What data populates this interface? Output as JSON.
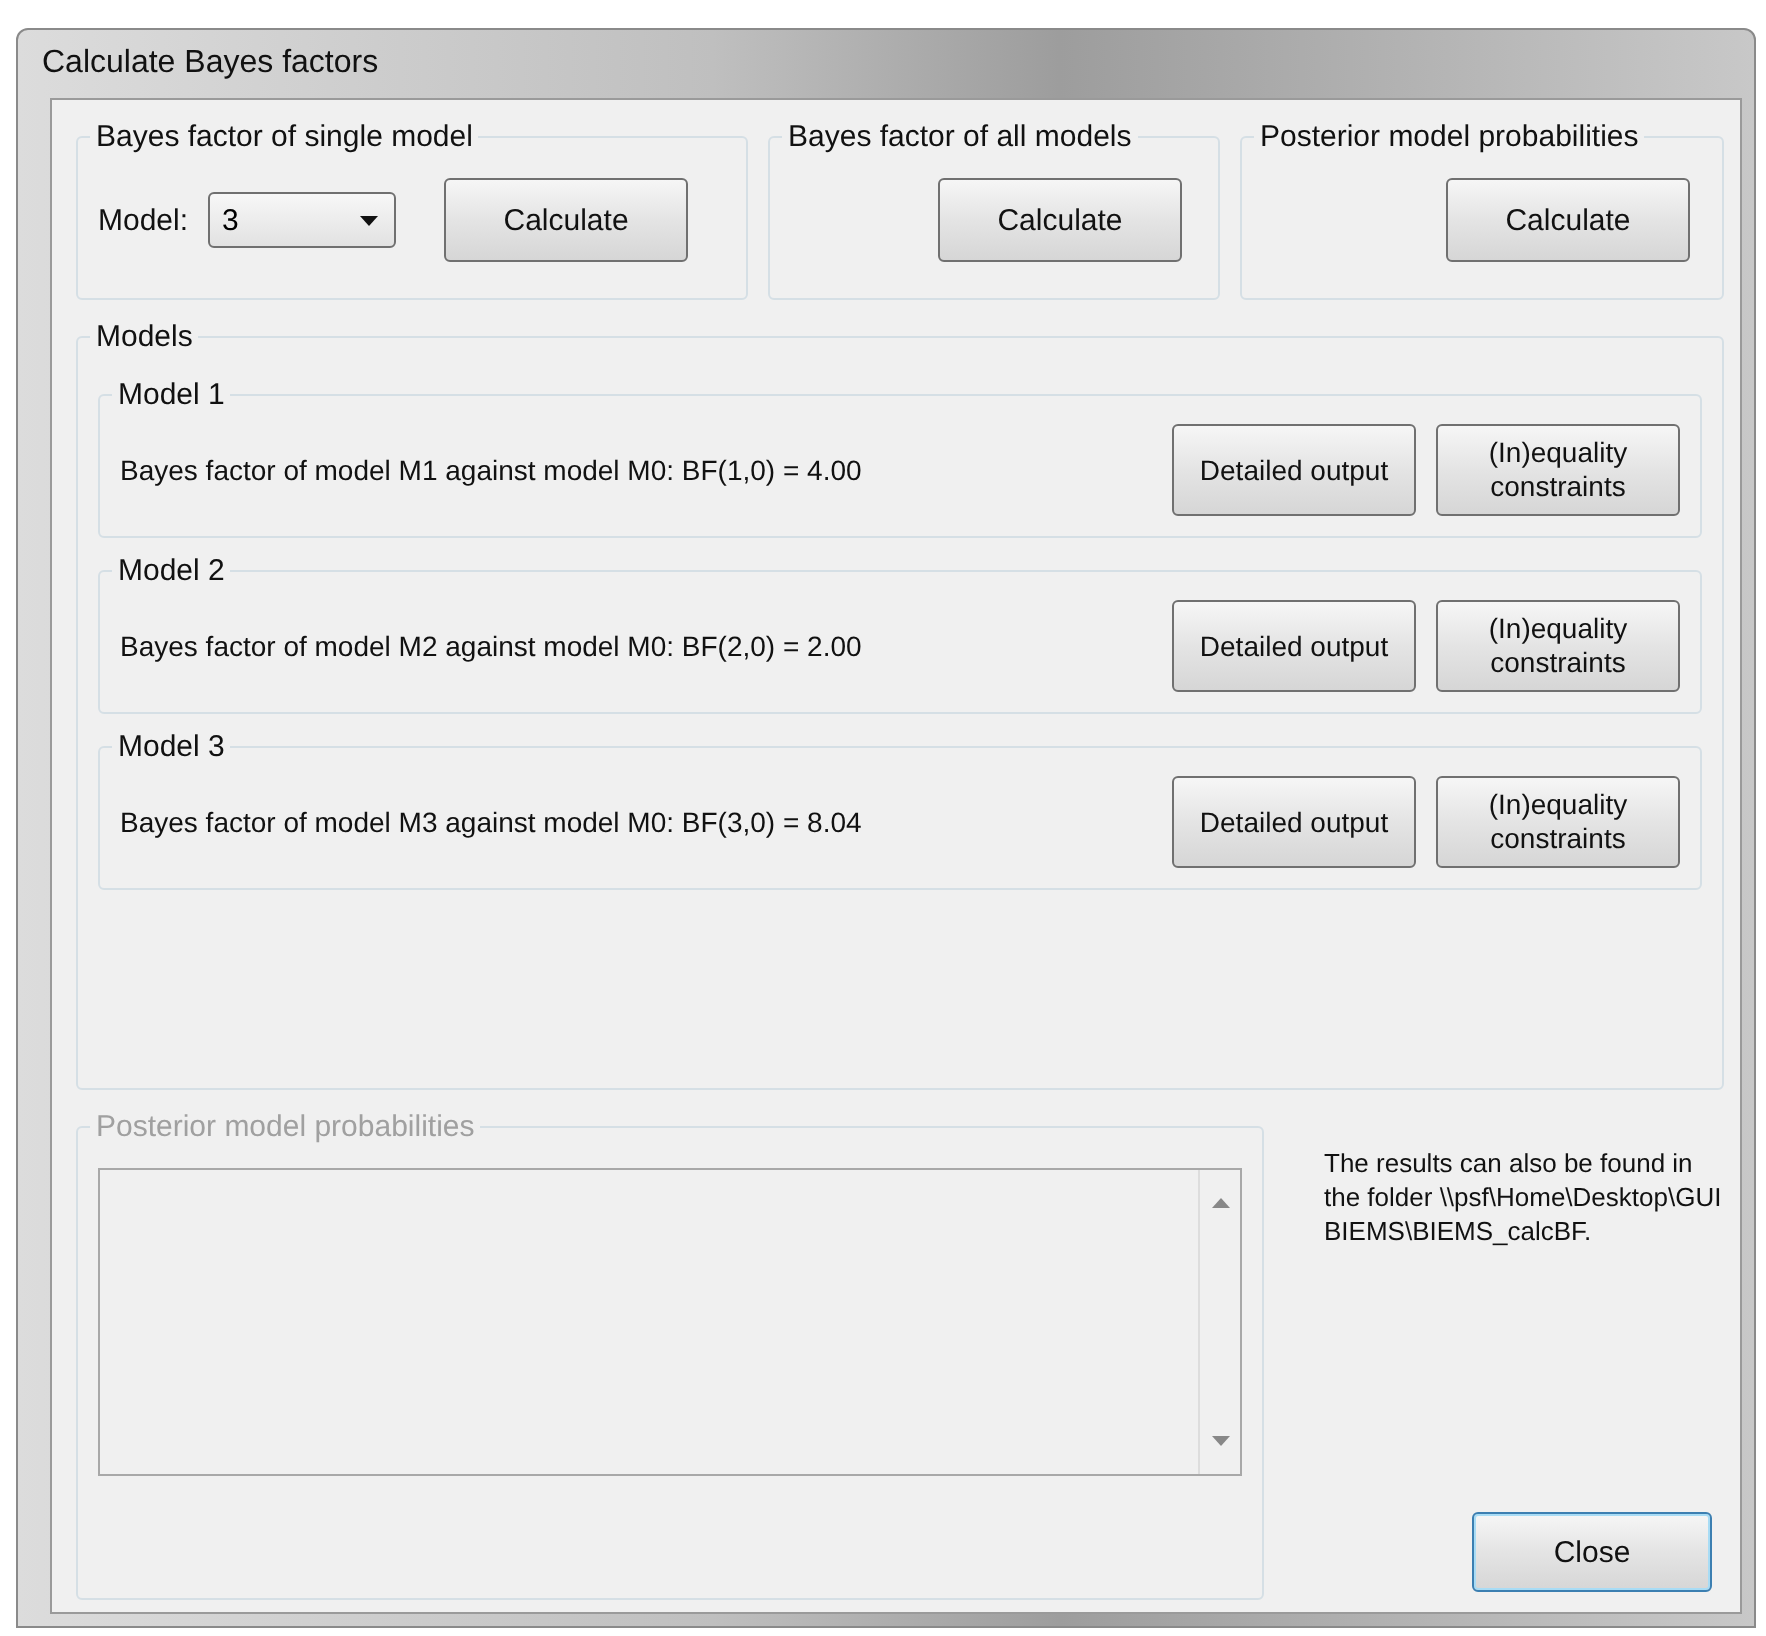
{
  "window": {
    "title": "Calculate Bayes factors"
  },
  "single_model": {
    "title": "Bayes factor of single model",
    "model_label": "Model:",
    "model_value": "3",
    "button": "Calculate"
  },
  "all_models": {
    "title": "Bayes factor of all models",
    "button": "Calculate"
  },
  "posterior": {
    "title": "Posterior model probabilities",
    "button": "Calculate"
  },
  "models": {
    "title": "Models",
    "items": [
      {
        "title": "Model 1",
        "text": "Bayes factor of model M1 against model M0: BF(1,0) = 4.00",
        "buttons": [
          "Detailed output",
          "(In)equality constraints"
        ]
      },
      {
        "title": "Model 2",
        "text": "Bayes factor of model M2 against model M0: BF(2,0) = 2.00",
        "buttons": [
          "Detailed output",
          "(In)equality constraints"
        ]
      },
      {
        "title": "Model 3",
        "text": "Bayes factor of model M3 against model M0: BF(3,0) = 8.04",
        "buttons": [
          "Detailed output",
          "(In)equality constraints"
        ]
      }
    ]
  },
  "posterior_output": {
    "title": "Posterior model probabilities",
    "disabled": true
  },
  "note": "The results can also be found in the folder \\\\psf\\Home\\Desktop\\GUI BIEMS\\BIEMS_calcBF.",
  "close_button": "Close"
}
